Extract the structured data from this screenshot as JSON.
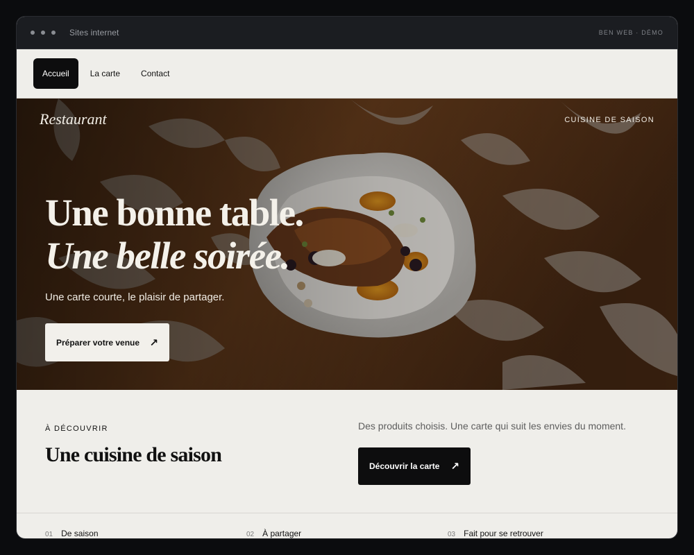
{
  "window": {
    "title": "Sites internet",
    "brand": "BEN WEB · DÉMO"
  },
  "nav": {
    "items": [
      {
        "label": "Accueil",
        "active": true
      },
      {
        "label": "La carte",
        "active": false
      },
      {
        "label": "Contact",
        "active": false
      }
    ]
  },
  "hero": {
    "logo": "Restaurant",
    "tagline": "CUISINE DE SAISON",
    "headline_line1": "Une bonne table.",
    "headline_line2": "Une belle soirée.",
    "subtitle": "Une carte courte, le plaisir de partager.",
    "cta_label": "Préparer votre venue",
    "cta_icon": "arrow-up-right-icon"
  },
  "discover": {
    "eyebrow": "À DÉCOUVRIR",
    "title": "Une cuisine de saison",
    "text": "Des produits choisis. Une carte qui suit les envies du moment.",
    "cta_label": "Découvrir la carte",
    "cta_icon": "arrow-up-right-icon"
  },
  "features": [
    {
      "num": "01",
      "label": "De saison"
    },
    {
      "num": "02",
      "label": "À partager"
    },
    {
      "num": "03",
      "label": "Fait pour se retrouver"
    }
  ],
  "colors": {
    "background": "#efeeea",
    "dark": "#0d0d0e",
    "titlebar": "#1b1d21"
  }
}
